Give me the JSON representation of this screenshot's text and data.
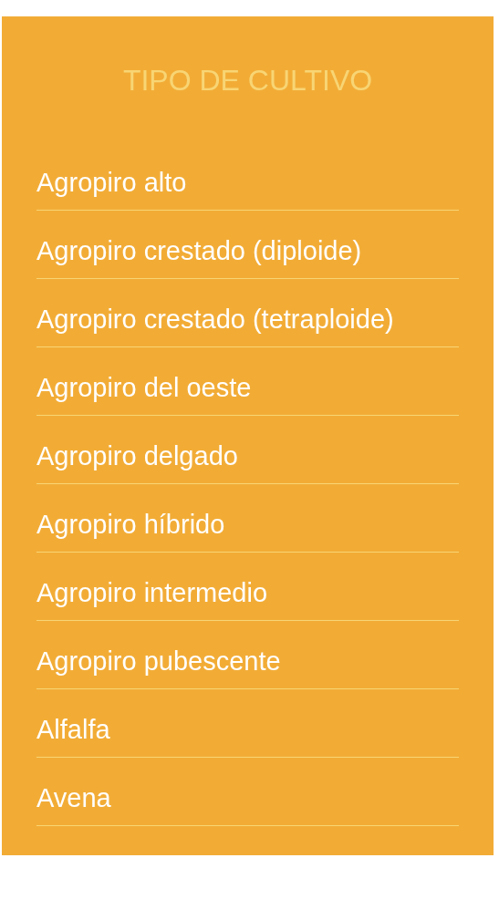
{
  "title": "TIPO DE CULTIVO",
  "items": [
    {
      "label": "Agropiro alto"
    },
    {
      "label": "Agropiro crestado (diploide)"
    },
    {
      "label": "Agropiro crestado (tetraploide)"
    },
    {
      "label": "Agropiro del oeste"
    },
    {
      "label": "Agropiro delgado"
    },
    {
      "label": "Agropiro híbrido"
    },
    {
      "label": "Agropiro intermedio"
    },
    {
      "label": "Agropiro pubescente"
    },
    {
      "label": "Alfalfa"
    },
    {
      "label": "Avena"
    }
  ]
}
